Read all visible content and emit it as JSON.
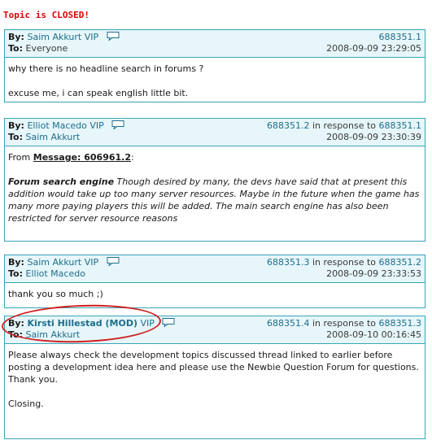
{
  "status_text": "Topic is CLOSED!",
  "labels": {
    "by": "By:",
    "to": "To:",
    "from": "From",
    "in_response_to": "in response to"
  },
  "posts": [
    {
      "author": "Saim Akkurt",
      "author_badge": "VIP",
      "id": "688351.1",
      "to": "Everyone",
      "date": "2008-09-09 23:29:05",
      "body": [
        "why there is no headline search in forums ?",
        "",
        "excuse me, i can speak english little bit."
      ]
    },
    {
      "author": "Elliot Macedo",
      "author_badge": "VIP",
      "id": "688351.2",
      "response_to": "688351.1",
      "to": "Saim Akkurt",
      "date": "2008-09-09 23:30:39",
      "quote_ref": "Message: 606961.2",
      "quote_title": "Forum search engine",
      "quote_text": "Though desired by many, the devs have said that at present this addition would take up too many server resources. Maybe in the future when the game has many more paying players this will be added. The main search engine has also been restricted for server resource reasons"
    },
    {
      "author": "Saim Akkurt",
      "author_badge": "VIP",
      "id": "688351.3",
      "response_to": "688351.2",
      "to": "Elliot Macedo",
      "date": "2008-09-09 23:33:53",
      "body": [
        "thank you so much ;)"
      ]
    },
    {
      "author": "Kirsti Hillestad (MOD)",
      "author_badge": "VIP",
      "id": "688351.4",
      "response_to": "688351.3",
      "to": "Saim Akkurt",
      "date": "2008-09-10 00:16:45",
      "body": [
        "Please always check the development topics discussed thread linked to earlier before posting a development idea here and please use the Newbie Question Forum for questions.",
        "Thank you.",
        "",
        "Closing."
      ]
    }
  ],
  "colors": {
    "border": "#36a6b8",
    "header_bg": "#e6f6fa",
    "link": "#1f6e8c",
    "closed": "#e00000",
    "highlight_oval": "#d21f1f"
  },
  "icons": {
    "message": "speech-bubble-icon"
  }
}
